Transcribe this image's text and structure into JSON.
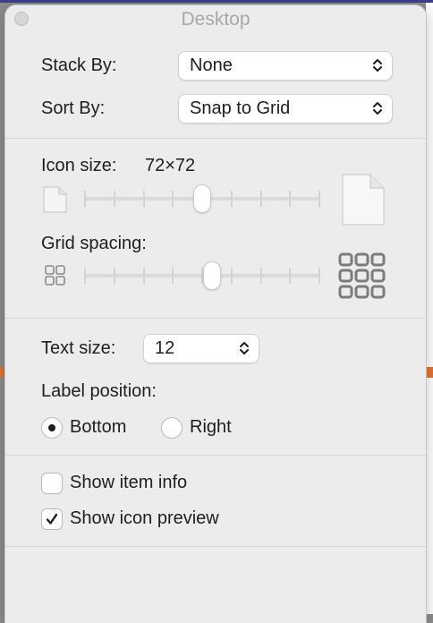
{
  "window": {
    "title": "Desktop"
  },
  "stack_by": {
    "label": "Stack By:",
    "value": "None"
  },
  "sort_by": {
    "label": "Sort By:",
    "value": "Snap to Grid"
  },
  "icon_size": {
    "label": "Icon size:",
    "value": "72×72",
    "level": 0.5
  },
  "grid_spacing": {
    "label": "Grid spacing:",
    "level": 0.54
  },
  "text_size": {
    "label": "Text size:",
    "value": "12"
  },
  "label_position": {
    "label": "Label position:",
    "options": [
      {
        "label": "Bottom",
        "selected": true
      },
      {
        "label": "Right",
        "selected": false
      }
    ]
  },
  "show_item_info": {
    "label": "Show item info",
    "checked": false
  },
  "show_icon_preview": {
    "label": "Show icon preview",
    "checked": true
  },
  "colors": {
    "panel": "#ececec",
    "track": "#dadada",
    "text": "#1e1e1e",
    "title": "#a8a8a8"
  },
  "icons": [
    "close-icon",
    "chevron-updown-icon",
    "small-document-icon",
    "large-document-icon",
    "small-grid-icon",
    "large-grid-icon",
    "checkmark-icon"
  ]
}
